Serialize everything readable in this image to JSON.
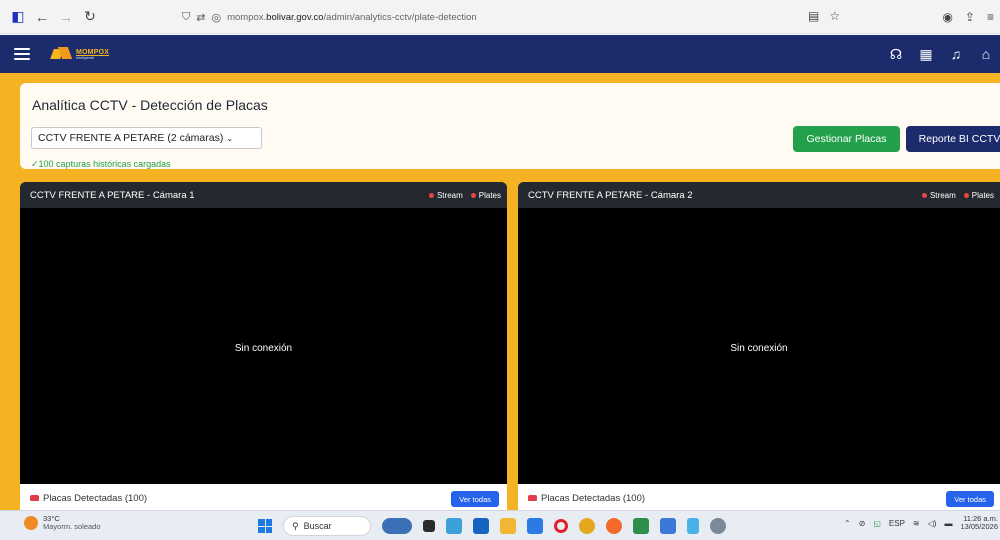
{
  "browser": {
    "url_domain": "mompox.bolivar.gov.co",
    "url_path": "/admin/analytics-cctv/plate-detection"
  },
  "header": {
    "logo_main": "MOMPOX",
    "logo_sub": "inteligente"
  },
  "top_card": {
    "title": "Analítica CCTV - Detección de Placas",
    "camera_select": "CCTV FRENTE A PETARE (2 cámaras)",
    "loaded_message": "✓100 capturas históricas cargadas",
    "btn_manage": "Gestionar Placas",
    "btn_report": "Reporte BI CCTV"
  },
  "cameras": [
    {
      "title": "CCTV FRENTE A PETARE - Cámara 1",
      "legend_stream": "Stream",
      "legend_plates": "Plates",
      "status": "Sin conexión",
      "detected": "Placas Detectadas (100)",
      "view_all": "Ver todas"
    },
    {
      "title": "CCTV FRENTE A PETARE - Cámara 2",
      "legend_stream": "Stream",
      "legend_plates": "Plates",
      "status": "Sin conexión",
      "detected": "Placas Detectadas (100)",
      "view_all": "Ver todas"
    }
  ],
  "taskbar": {
    "temp": "33°C",
    "weather": "Mayorm. soleado",
    "search": "Buscar",
    "lang": "ESP",
    "time": "11:26 a.m.",
    "date": "13/05/2026"
  },
  "colors": {
    "navy": "#1b2b6b",
    "accent": "#f5b324",
    "green": "#22a14a",
    "blue": "#2563eb"
  }
}
